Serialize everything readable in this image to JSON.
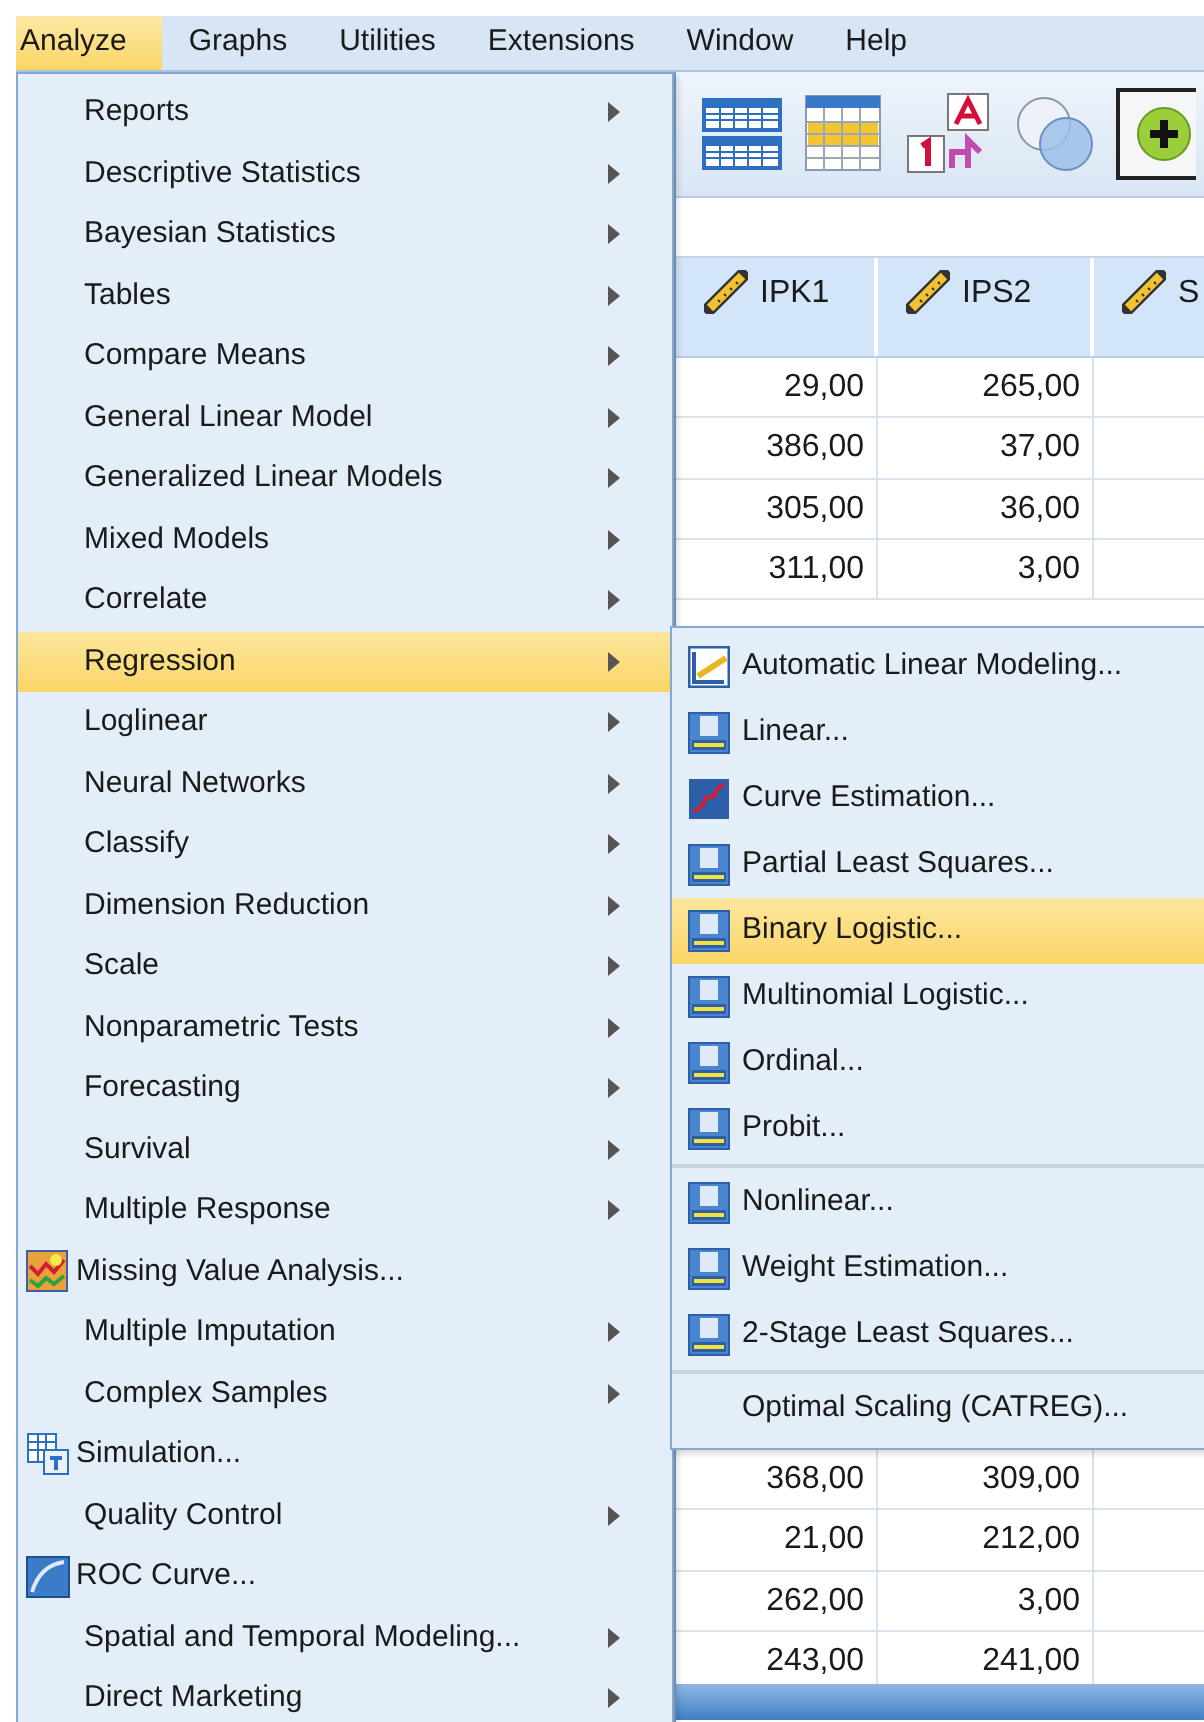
{
  "menubar": [
    {
      "label": "Analyze",
      "selected": true
    },
    {
      "label": "Graphs",
      "selected": false
    },
    {
      "label": "Utilities",
      "selected": false
    },
    {
      "label": "Extensions",
      "selected": false
    },
    {
      "label": "Window",
      "selected": false
    },
    {
      "label": "Help",
      "selected": false
    }
  ],
  "analyze_menu": [
    {
      "label": "Reports",
      "kind": "submenu",
      "selected": false
    },
    {
      "label": "Descriptive Statistics",
      "kind": "submenu",
      "selected": false
    },
    {
      "label": "Bayesian Statistics",
      "kind": "submenu",
      "selected": false
    },
    {
      "label": "Tables",
      "kind": "submenu",
      "selected": false
    },
    {
      "label": "Compare Means",
      "kind": "submenu",
      "selected": false
    },
    {
      "label": "General Linear Model",
      "kind": "submenu",
      "selected": false
    },
    {
      "label": "Generalized Linear Models",
      "kind": "submenu",
      "selected": false
    },
    {
      "label": "Mixed Models",
      "kind": "submenu",
      "selected": false
    },
    {
      "label": "Correlate",
      "kind": "submenu",
      "selected": false
    },
    {
      "label": "Regression",
      "kind": "submenu",
      "selected": true
    },
    {
      "label": "Loglinear",
      "kind": "submenu",
      "selected": false
    },
    {
      "label": "Neural Networks",
      "kind": "submenu",
      "selected": false
    },
    {
      "label": "Classify",
      "kind": "submenu",
      "selected": false
    },
    {
      "label": "Dimension Reduction",
      "kind": "submenu",
      "selected": false
    },
    {
      "label": "Scale",
      "kind": "submenu",
      "selected": false
    },
    {
      "label": "Nonparametric Tests",
      "kind": "submenu",
      "selected": false
    },
    {
      "label": "Forecasting",
      "kind": "submenu",
      "selected": false
    },
    {
      "label": "Survival",
      "kind": "submenu",
      "selected": false
    },
    {
      "label": "Multiple Response",
      "kind": "submenu",
      "selected": false
    },
    {
      "label": "Missing Value Analysis...",
      "kind": "dialog",
      "selected": false
    },
    {
      "label": "Multiple Imputation",
      "kind": "submenu",
      "selected": false
    },
    {
      "label": "Complex Samples",
      "kind": "submenu",
      "selected": false
    },
    {
      "label": "Simulation...",
      "kind": "dialog",
      "selected": false
    },
    {
      "label": "Quality Control",
      "kind": "submenu",
      "selected": false
    },
    {
      "label": "ROC Curve...",
      "kind": "dialog",
      "selected": false
    },
    {
      "label": "Spatial and Temporal Modeling...",
      "kind": "submenu",
      "selected": false
    },
    {
      "label": "Direct Marketing",
      "kind": "submenu",
      "selected": false
    }
  ],
  "regression_menu": [
    {
      "label": "Automatic Linear Modeling...",
      "selected": false,
      "separator_before": false
    },
    {
      "label": "Linear...",
      "selected": false,
      "separator_before": false
    },
    {
      "label": "Curve Estimation...",
      "selected": false,
      "separator_before": false
    },
    {
      "label": "Partial Least Squares...",
      "selected": false,
      "separator_before": false
    },
    {
      "label": "Binary Logistic...",
      "selected": true,
      "separator_before": false
    },
    {
      "label": "Multinomial Logistic...",
      "selected": false,
      "separator_before": false
    },
    {
      "label": "Ordinal...",
      "selected": false,
      "separator_before": false
    },
    {
      "label": "Probit...",
      "selected": false,
      "separator_before": false
    },
    {
      "label": "Nonlinear...",
      "selected": false,
      "separator_before": true
    },
    {
      "label": "Weight Estimation...",
      "selected": false,
      "separator_before": false
    },
    {
      "label": "2-Stage Least Squares...",
      "selected": false,
      "separator_before": false
    },
    {
      "label": "Optimal Scaling (CATREG)...",
      "selected": false,
      "separator_before": true
    }
  ],
  "data_grid": {
    "columns": [
      "IPK1",
      "IPS2",
      "S"
    ],
    "rows_above": [
      [
        "29,00",
        "265,00"
      ],
      [
        "386,00",
        "37,00"
      ],
      [
        "305,00",
        "36,00"
      ],
      [
        "311,00",
        "3,00"
      ]
    ],
    "rows_below": [
      [
        "368,00",
        "309,00"
      ],
      [
        "21,00",
        "212,00"
      ],
      [
        "262,00",
        "3,00"
      ],
      [
        "243,00",
        "241,00"
      ]
    ]
  }
}
